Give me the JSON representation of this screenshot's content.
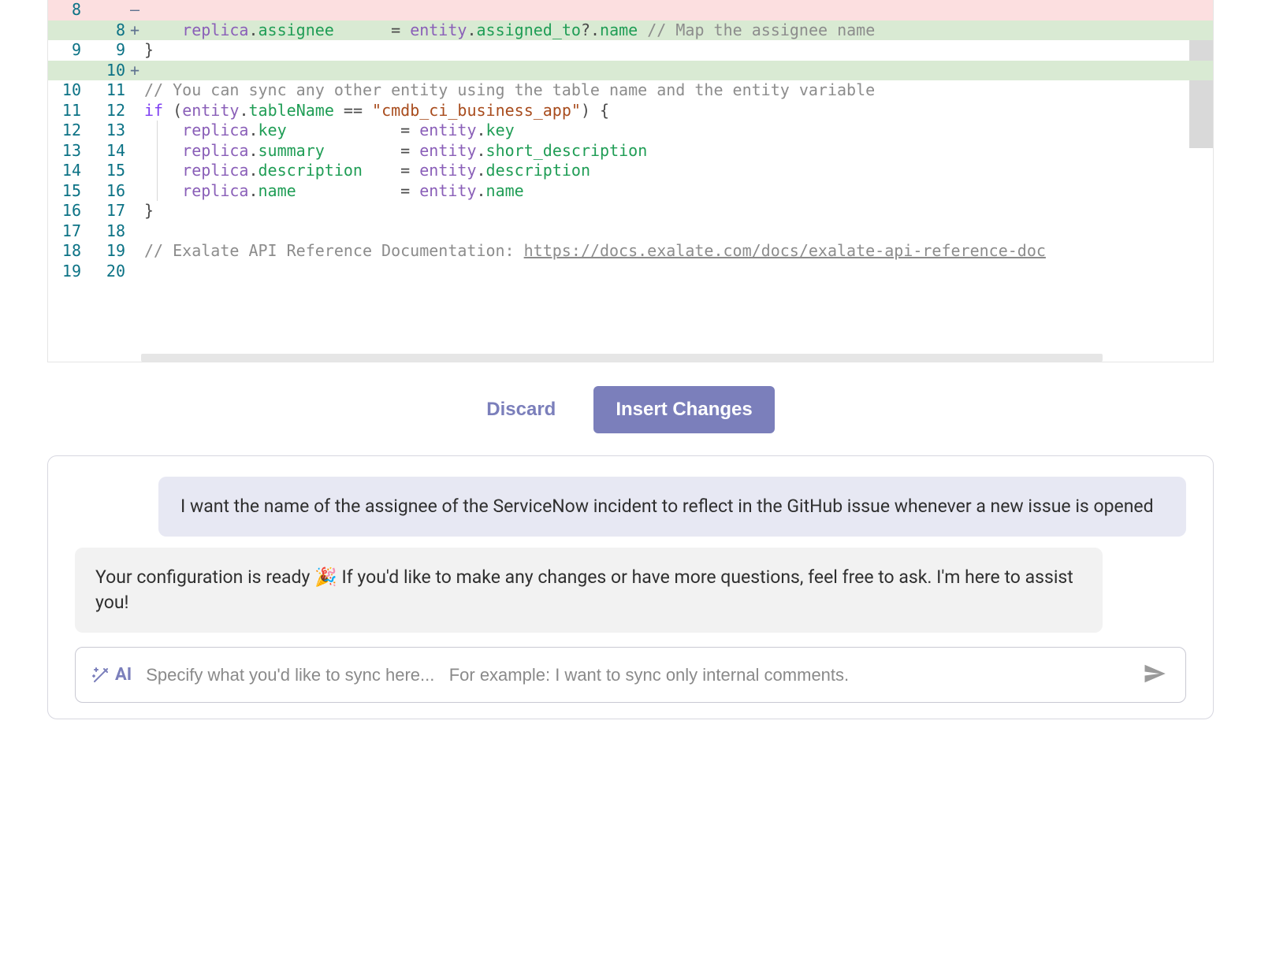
{
  "diff": {
    "rows": [
      {
        "old": "8",
        "new": "",
        "mark": "—",
        "kind": "del",
        "code": ""
      },
      {
        "old": "",
        "new": "8",
        "mark": "+",
        "kind": "add",
        "code": "    replica.assignee      = entity.assigned_to?.name // Map the assignee name",
        "tokens": [
          {
            "t": "    ",
            "c": ""
          },
          {
            "t": "replica",
            "c": "tk-var"
          },
          {
            "t": ".",
            "c": "tk-pun"
          },
          {
            "t": "assignee",
            "c": "tk-prop"
          },
          {
            "t": "      ",
            "c": ""
          },
          {
            "t": "= ",
            "c": "tk-eq"
          },
          {
            "t": "entity",
            "c": "tk-var"
          },
          {
            "t": ".",
            "c": "tk-pun"
          },
          {
            "t": "assigned_to",
            "c": "tk-prop"
          },
          {
            "t": "?",
            "c": "tk-pun"
          },
          {
            "t": ".",
            "c": "tk-pun"
          },
          {
            "t": "name",
            "c": "tk-prop"
          },
          {
            "t": " ",
            "c": ""
          },
          {
            "t": "// Map the assignee name",
            "c": "tk-cmt"
          }
        ]
      },
      {
        "old": "9",
        "new": "9",
        "mark": "",
        "kind": "ctx",
        "tokens": [
          {
            "t": "}",
            "c": "tk-pun"
          }
        ]
      },
      {
        "old": "",
        "new": "10",
        "mark": "+",
        "kind": "add-empty",
        "tokens": [
          {
            "t": "",
            "c": ""
          }
        ]
      },
      {
        "old": "10",
        "new": "11",
        "mark": "",
        "kind": "ctx",
        "tokens": [
          {
            "t": "// You can sync any other entity using the table name and the entity variable",
            "c": "tk-cmt"
          }
        ]
      },
      {
        "old": "11",
        "new": "12",
        "mark": "",
        "kind": "ctx",
        "tokens": [
          {
            "t": "if",
            "c": "tk-kw"
          },
          {
            "t": " (",
            "c": "tk-pun"
          },
          {
            "t": "entity",
            "c": "tk-var"
          },
          {
            "t": ".",
            "c": "tk-pun"
          },
          {
            "t": "tableName",
            "c": "tk-prop"
          },
          {
            "t": " == ",
            "c": "tk-pun"
          },
          {
            "t": "\"cmdb_ci_business_app\"",
            "c": "tk-str"
          },
          {
            "t": ") {",
            "c": "tk-pun"
          }
        ]
      },
      {
        "old": "12",
        "new": "13",
        "mark": "",
        "kind": "ctx",
        "indent": true,
        "tokens": [
          {
            "t": "    ",
            "c": ""
          },
          {
            "t": "replica",
            "c": "tk-var"
          },
          {
            "t": ".",
            "c": "tk-pun"
          },
          {
            "t": "key",
            "c": "tk-prop"
          },
          {
            "t": "            ",
            "c": ""
          },
          {
            "t": "= ",
            "c": "tk-eq"
          },
          {
            "t": "entity",
            "c": "tk-var"
          },
          {
            "t": ".",
            "c": "tk-pun"
          },
          {
            "t": "key",
            "c": "tk-prop"
          }
        ]
      },
      {
        "old": "13",
        "new": "14",
        "mark": "",
        "kind": "ctx",
        "indent": true,
        "tokens": [
          {
            "t": "    ",
            "c": ""
          },
          {
            "t": "replica",
            "c": "tk-var"
          },
          {
            "t": ".",
            "c": "tk-pun"
          },
          {
            "t": "summary",
            "c": "tk-prop"
          },
          {
            "t": "        ",
            "c": ""
          },
          {
            "t": "= ",
            "c": "tk-eq"
          },
          {
            "t": "entity",
            "c": "tk-var"
          },
          {
            "t": ".",
            "c": "tk-pun"
          },
          {
            "t": "short_description",
            "c": "tk-prop"
          }
        ]
      },
      {
        "old": "14",
        "new": "15",
        "mark": "",
        "kind": "ctx",
        "indent": true,
        "tokens": [
          {
            "t": "    ",
            "c": ""
          },
          {
            "t": "replica",
            "c": "tk-var"
          },
          {
            "t": ".",
            "c": "tk-pun"
          },
          {
            "t": "description",
            "c": "tk-prop"
          },
          {
            "t": "    ",
            "c": ""
          },
          {
            "t": "= ",
            "c": "tk-eq"
          },
          {
            "t": "entity",
            "c": "tk-var"
          },
          {
            "t": ".",
            "c": "tk-pun"
          },
          {
            "t": "description",
            "c": "tk-prop"
          }
        ]
      },
      {
        "old": "15",
        "new": "16",
        "mark": "",
        "kind": "ctx",
        "indent": true,
        "tokens": [
          {
            "t": "    ",
            "c": ""
          },
          {
            "t": "replica",
            "c": "tk-var"
          },
          {
            "t": ".",
            "c": "tk-pun"
          },
          {
            "t": "name",
            "c": "tk-prop"
          },
          {
            "t": "           ",
            "c": ""
          },
          {
            "t": "= ",
            "c": "tk-eq"
          },
          {
            "t": "entity",
            "c": "tk-var"
          },
          {
            "t": ".",
            "c": "tk-pun"
          },
          {
            "t": "name",
            "c": "tk-prop"
          }
        ]
      },
      {
        "old": "16",
        "new": "17",
        "mark": "",
        "kind": "ctx",
        "tokens": [
          {
            "t": "}",
            "c": "tk-pun"
          }
        ]
      },
      {
        "old": "17",
        "new": "18",
        "mark": "",
        "kind": "ctx",
        "tokens": [
          {
            "t": "",
            "c": ""
          }
        ]
      },
      {
        "old": "18",
        "new": "19",
        "mark": "",
        "kind": "ctx",
        "tokens": [
          {
            "t": "// Exalate API Reference Documentation: ",
            "c": "tk-cmt"
          },
          {
            "t": "https://docs.exalate.com/docs/exalate-api-reference-doc",
            "c": "tk-link"
          }
        ]
      },
      {
        "old": "19",
        "new": "20",
        "mark": "",
        "kind": "ctx",
        "tokens": [
          {
            "t": "",
            "c": ""
          }
        ]
      }
    ]
  },
  "actions": {
    "discard": "Discard",
    "insert": "Insert Changes"
  },
  "chat": {
    "user_msg": "I want the name of the assignee of the ServiceNow incident to reflect in the GitHub issue whenever a new issue is opened",
    "ai_msg_pre": "Your configuration is ready ",
    "ai_emoji": "🎉",
    "ai_msg_post": " If you'd like to make any changes or have more questions, feel free to ask. I'm here to assist you!",
    "badge": "AI",
    "placeholder": "Specify what you'd like to sync here...   For example: I want to sync only internal comments."
  }
}
